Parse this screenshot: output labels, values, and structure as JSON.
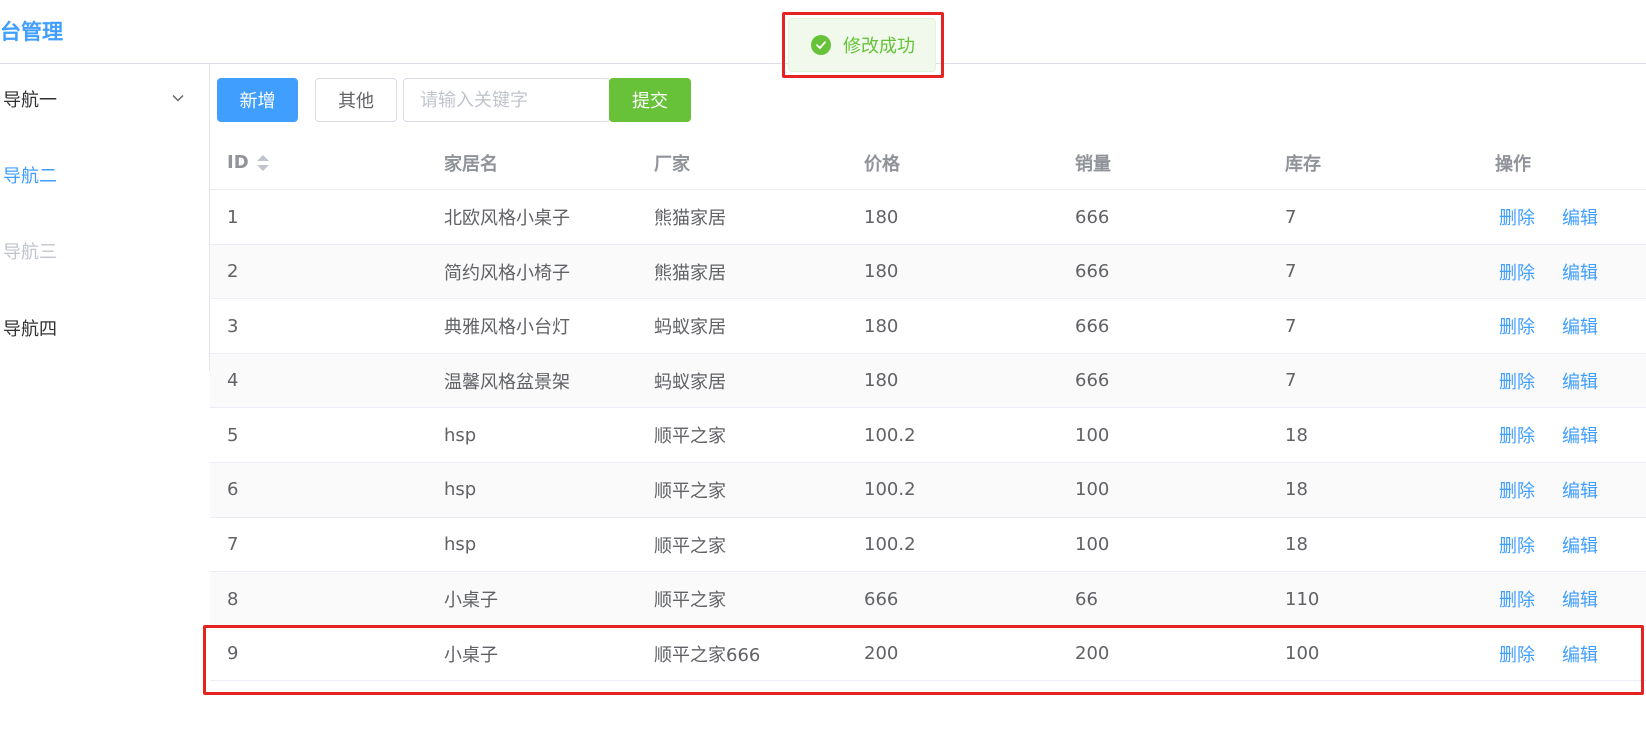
{
  "header": {
    "title": "台管理"
  },
  "toast": {
    "message": "修改成功"
  },
  "sidebar": {
    "items": [
      {
        "label": "导航一",
        "state": "normal",
        "has_submenu": true
      },
      {
        "label": "导航二",
        "state": "active"
      },
      {
        "label": "导航三",
        "state": "disabled"
      },
      {
        "label": "导航四",
        "state": "normal"
      }
    ]
  },
  "toolbar": {
    "add_label": "新增",
    "other_label": "其他",
    "search_placeholder": "请输入关键字",
    "search_value": "",
    "submit_label": "提交"
  },
  "table": {
    "columns": [
      "ID",
      "家居名",
      "厂家",
      "价格",
      "销量",
      "库存",
      "操作"
    ],
    "actions": {
      "delete": "删除",
      "edit": "编辑"
    },
    "rows": [
      {
        "id": "1",
        "name": "北欧风格小桌子",
        "maker": "熊猫家居",
        "price": "180",
        "sales": "666",
        "stock": "7"
      },
      {
        "id": "2",
        "name": "简约风格小椅子",
        "maker": "熊猫家居",
        "price": "180",
        "sales": "666",
        "stock": "7"
      },
      {
        "id": "3",
        "name": "典雅风格小台灯",
        "maker": "蚂蚁家居",
        "price": "180",
        "sales": "666",
        "stock": "7"
      },
      {
        "id": "4",
        "name": "温馨风格盆景架",
        "maker": "蚂蚁家居",
        "price": "180",
        "sales": "666",
        "stock": "7"
      },
      {
        "id": "5",
        "name": "hsp",
        "maker": "顺平之家",
        "price": "100.2",
        "sales": "100",
        "stock": "18"
      },
      {
        "id": "6",
        "name": "hsp",
        "maker": "顺平之家",
        "price": "100.2",
        "sales": "100",
        "stock": "18"
      },
      {
        "id": "7",
        "name": "hsp",
        "maker": "顺平之家",
        "price": "100.2",
        "sales": "100",
        "stock": "18"
      },
      {
        "id": "8",
        "name": "小桌子",
        "maker": "顺平之家",
        "price": "666",
        "sales": "66",
        "stock": "110"
      },
      {
        "id": "9",
        "name": "小桌子",
        "maker": "顺平之家666",
        "price": "200",
        "sales": "200",
        "stock": "100"
      }
    ]
  },
  "colors": {
    "primary": "#409eff",
    "success": "#67c23a",
    "highlight": "#e52421"
  }
}
